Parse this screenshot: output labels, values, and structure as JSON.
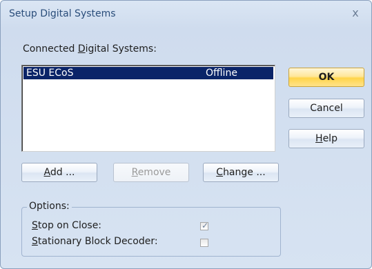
{
  "window": {
    "title": "Setup Digital Systems",
    "close_glyph": "x"
  },
  "systems": {
    "label_prefix": "Connected ",
    "label_mnemonic": "D",
    "label_suffix": "igital Systems:",
    "rows": [
      {
        "name": "ESU ECoS",
        "status": "Offline",
        "selected": true
      }
    ]
  },
  "buttons": {
    "ok": "OK",
    "cancel": "Cancel",
    "help_mnemonic": "H",
    "help_rest": "elp",
    "add_mnemonic": "A",
    "add_rest": "dd ...",
    "remove_mnemonic": "R",
    "remove_rest": "emove",
    "change_mnemonic": "C",
    "change_rest": "hange ..."
  },
  "options": {
    "title": "Options:",
    "stop_on_close": {
      "mnemonic": "S",
      "rest": "top on Close:",
      "checked": true,
      "check_glyph": "✓"
    },
    "stationary_block": {
      "mnemonic": "S",
      "rest": "tationary Block Decoder:",
      "checked": false
    }
  }
}
